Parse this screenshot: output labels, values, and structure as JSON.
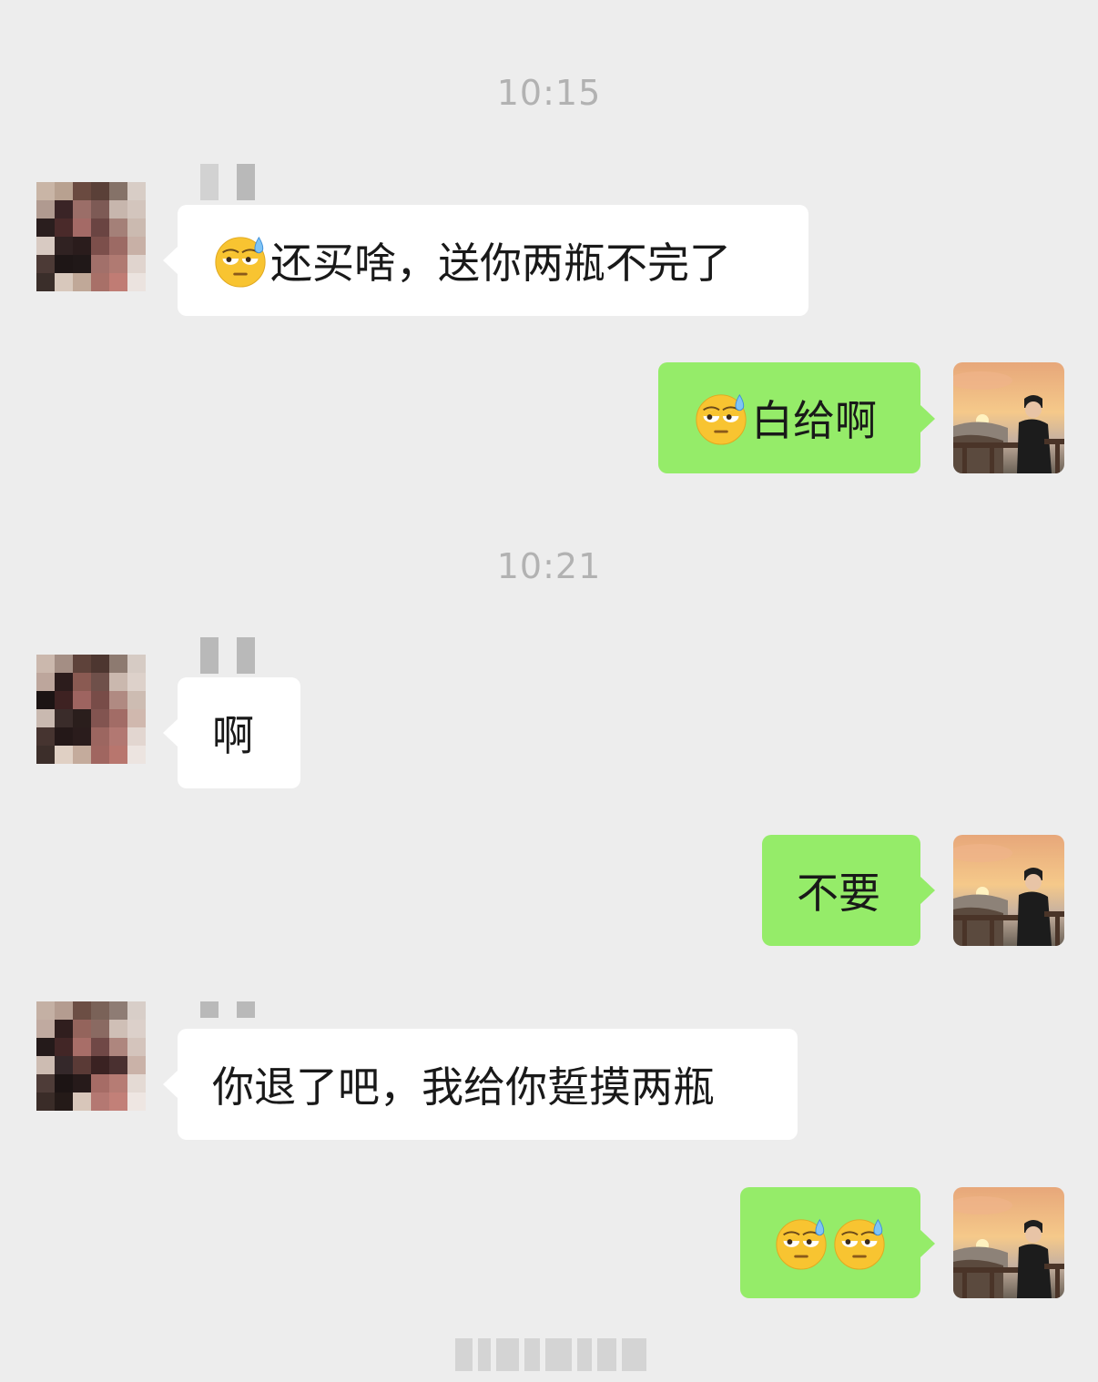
{
  "timestamps": [
    "10:15",
    "10:21"
  ],
  "messages": [
    {
      "side": "left",
      "emoji_count": 1,
      "text": "还买啥，送你两瓶不完了"
    },
    {
      "side": "right",
      "emoji_count": 1,
      "text": "白给啊"
    },
    {
      "side": "left",
      "emoji_count": 0,
      "text": "啊"
    },
    {
      "side": "right",
      "emoji_count": 0,
      "text": "不要"
    },
    {
      "side": "left",
      "emoji_count": 0,
      "text": "你退了吧，我给你踅摸两瓶"
    },
    {
      "side": "right",
      "emoji_count": 2,
      "text": ""
    }
  ],
  "emoji_name": "sweat-eye-roll-emoji-icon",
  "colors": {
    "background": "#ededed",
    "incoming_bubble": "#ffffff",
    "outgoing_bubble": "#95ec69",
    "timestamp": "#b2b2b2",
    "text": "#191919"
  }
}
